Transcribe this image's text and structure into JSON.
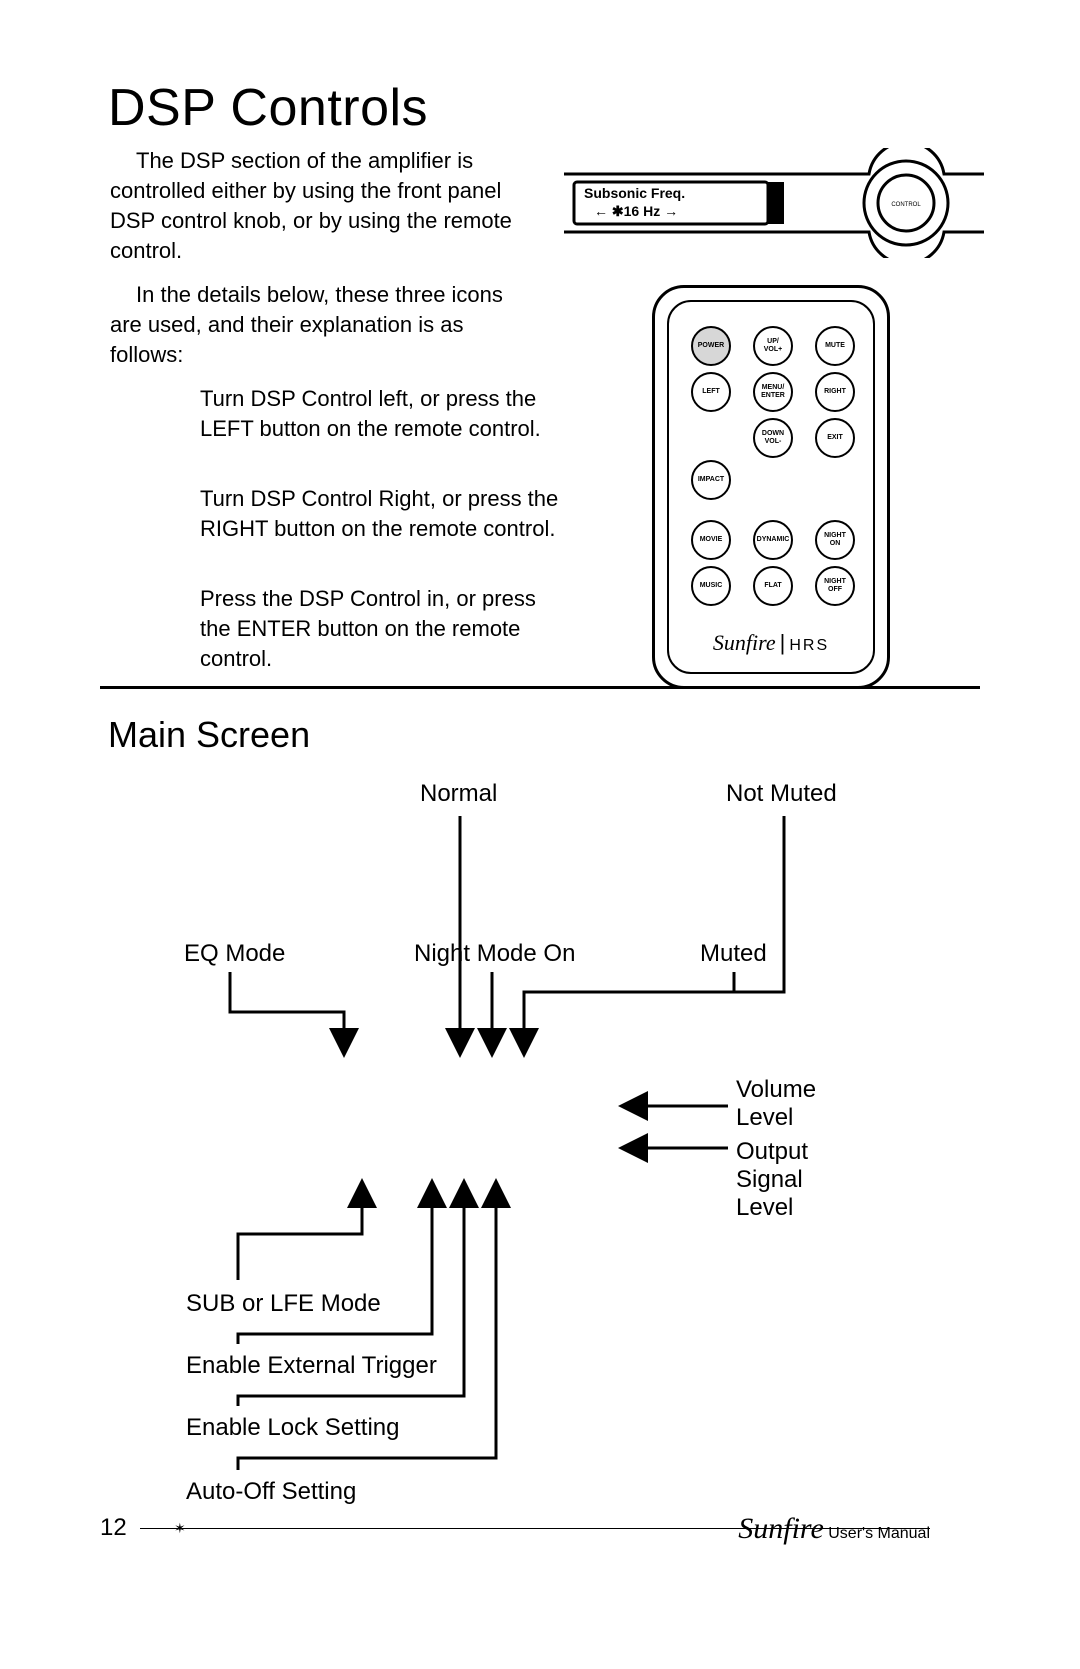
{
  "title": "DSP Controls",
  "para1": "The DSP section of the amplifier is controlled either by using the front panel DSP control knob, or by using the remote control.",
  "para2": "In the details below, these three icons are used, and their explanation is as follows:",
  "iconDesc": {
    "left": "Turn DSP Control left, or press the LEFT button on the remote control.",
    "right": "Turn DSP Control Right, or press the RIGHT button on the remote control.",
    "enter": "Press the DSP Control in, or press the ENTER button on the remote control."
  },
  "frontPanel": {
    "line1": "Subsonic  Freq.",
    "line2": "←  ✱16 Hz  →",
    "knob": "CONTROL"
  },
  "remote": {
    "buttons": {
      "power": "POWER",
      "up": "UP/\nVOL+",
      "mute": "MUTE",
      "left": "LEFT",
      "menu": "MENU/\nENTER",
      "right": "RIGHT",
      "down": "DOWN\nVOL-",
      "exit": "EXIT",
      "impact": "IMPACT",
      "movie": "MOVIE",
      "dynamic": "DYNAMIC",
      "nighton": "NIGHT\nON",
      "music": "MUSIC",
      "flat": "FLAT",
      "nightoff": "NIGHT\nOFF"
    },
    "brand": "Sunfire",
    "brand2": "HRS"
  },
  "section2Title": "Main Screen",
  "diagramLabels": {
    "normal": "Normal",
    "notMuted": "Not Muted",
    "eqMode": "EQ Mode",
    "nightModeOn": "Night Mode On",
    "muted": "Muted",
    "volumeLevel": "Volume\nLevel",
    "outputSignalLevel": "Output\nSignal\nLevel",
    "subLfe": "SUB or LFE Mode",
    "extTrigger": "Enable External Trigger",
    "lock": "Enable Lock Setting",
    "autoOff": "Auto-Off Setting"
  },
  "footer": {
    "pageNum": "12",
    "brand": "Sunfire",
    "suffix": " User's Manual"
  }
}
